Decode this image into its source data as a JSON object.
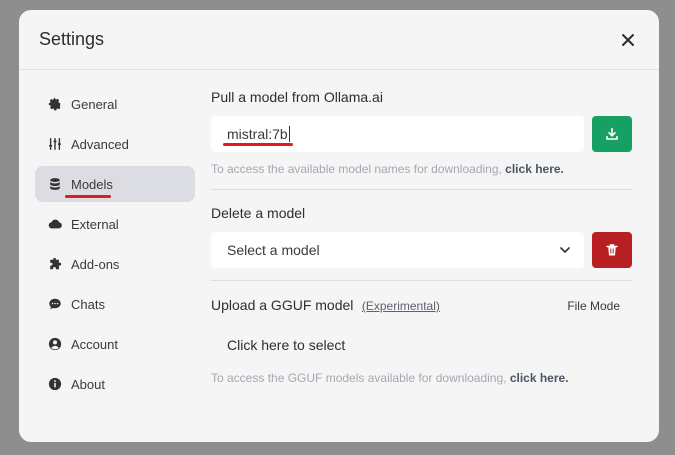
{
  "modal": {
    "title": "Settings"
  },
  "sidebar": {
    "items": [
      {
        "label": "General",
        "icon": "gear-icon"
      },
      {
        "label": "Advanced",
        "icon": "sliders-icon"
      },
      {
        "label": "Models",
        "icon": "database-icon",
        "active": true
      },
      {
        "label": "External",
        "icon": "cloud-icon"
      },
      {
        "label": "Add-ons",
        "icon": "puzzle-icon"
      },
      {
        "label": "Chats",
        "icon": "chat-icon"
      },
      {
        "label": "Account",
        "icon": "user-circle-icon"
      },
      {
        "label": "About",
        "icon": "info-icon"
      }
    ]
  },
  "pull": {
    "title": "Pull a model from Ollama.ai",
    "input_value": "mistral:7b",
    "hint": "To access the available model names for downloading, ",
    "hint_link": "click here."
  },
  "delete": {
    "title": "Delete a model",
    "select_value": "Select a model"
  },
  "upload": {
    "title": "Upload a GGUF model",
    "experimental": "(Experimental)",
    "file_mode": "File Mode",
    "select_label": "Click here to select",
    "hint": "To access the GGUF models available for downloading, ",
    "hint_link": "click here."
  },
  "colors": {
    "download_button": "#16a064",
    "delete_button": "#b81f23",
    "annotation": "#e01b24"
  }
}
